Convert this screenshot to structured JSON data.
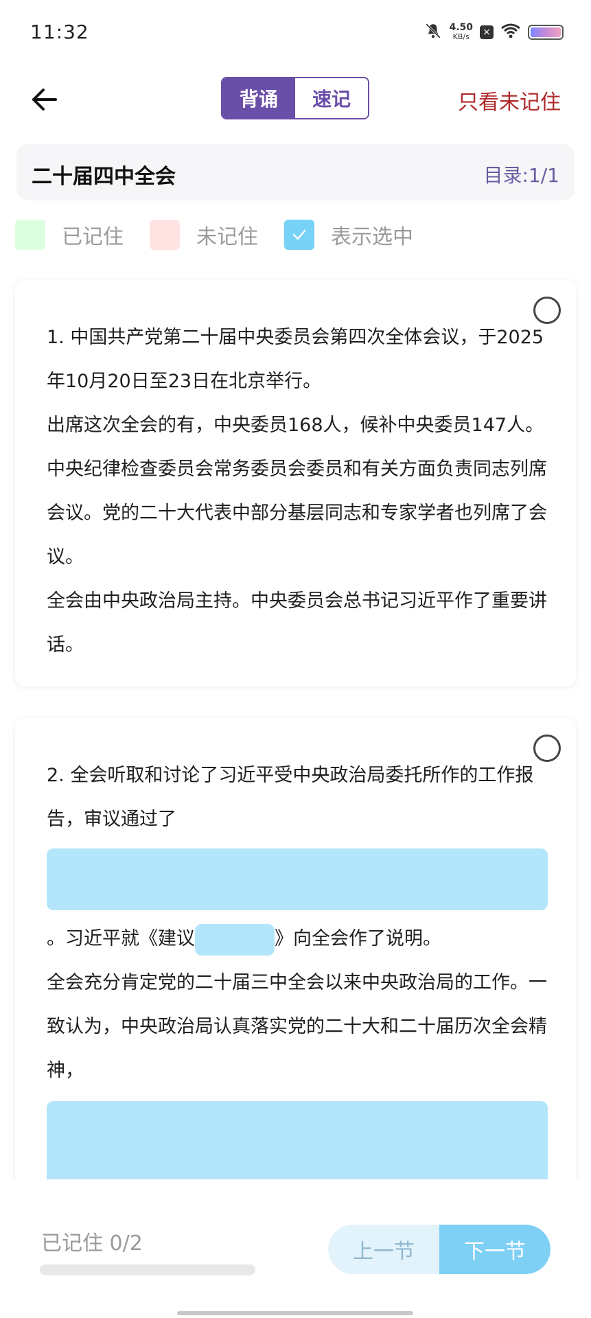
{
  "status_bar": {
    "time": "11:32",
    "net_speed_value": "4.50",
    "net_speed_unit": "KB/s",
    "icons": [
      "bell-muted-icon",
      "sim-blocked-icon",
      "wifi-icon",
      "battery-icon"
    ]
  },
  "nav": {
    "back_icon": "arrow-left-icon",
    "tabs": [
      {
        "label": "背诵",
        "active": true
      },
      {
        "label": "速记",
        "active": false
      }
    ],
    "filter_label": "只看未记住"
  },
  "section": {
    "title": "二十届四中全会",
    "catalog": "目录:1/1"
  },
  "legend": [
    {
      "label": "已记住",
      "color": "#dcffdf"
    },
    {
      "label": "未记住",
      "color": "#ffe3e3"
    },
    {
      "label": "表示选中",
      "color": "#78d2f8"
    }
  ],
  "cards": [
    {
      "paragraphs": [
        "1. 中国共产党第二十届中央委员会第四次全体会议，于2025年10月20日至23日在北京举行。",
        "出席这次全会的有，中央委员168人，候补中央委员147人。中央纪律检查委员会常务委员会委员和有关方面负责同志列席会议。党的二十大代表中部分基层同志和专家学者也列席了会议。",
        "全会由中央政治局主持。中央委员会总书记习近平作了重要讲话。"
      ]
    },
    {
      "part1": "2. 全会听取和讨论了习近平受中央政治局委托所作的工作报告，审议通过了",
      "part2_before": "。习近平就《建议",
      "part2_after": "》向全会作了说明。",
      "part3": "全会充分肯定党的二十届三中全会以来中央政治局的工作。一致认为，中央政治局认真落实党的二十大和二十届历次全会精神，"
    }
  ],
  "bottom": {
    "progress_label": "已记住 0/2",
    "progress_fraction": 0,
    "prev_label": "上一节",
    "next_label": "下一节"
  },
  "colors": {
    "accent": "#6a4fa8",
    "filter_red": "#b02a2a",
    "blank_blue": "#b3e5fb"
  }
}
